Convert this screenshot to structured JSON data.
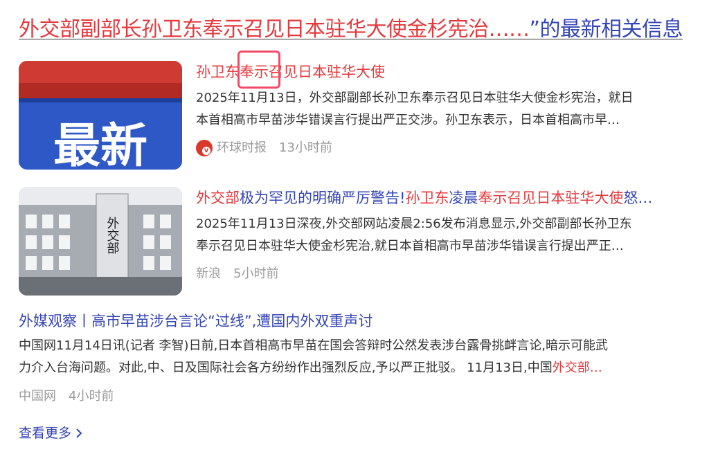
{
  "header": {
    "title_red": "外交部副部长孙卫东奉示召见日本驻华大使金杉宪治……",
    "title_blue": "”的最新相关信息"
  },
  "results": [
    {
      "thumb_text": "最新",
      "title": "孙卫东奉示召见日本驻华大使",
      "body_line1": "2025年11月13日，外交部副部长孙卫东奉示召见日本驻华大使金杉宪治，就日",
      "body_line2": "本首相高市早苗涉华错误言行提出严正交涉。孙卫东表示，日本首相高市早…",
      "source": "环球时报",
      "time": "13小时前"
    },
    {
      "title_parts": [
        "外交部",
        "极为罕见的明确严厉警告!",
        "孙卫东",
        "凌晨",
        "奉示召见日本驻华大使",
        "怒…"
      ],
      "thumb_sign": "外交部",
      "body_line1": "2025年11月13日深夜,外交部网站凌晨2:56发布消息显示,外交部副部长孙卫东",
      "body_line2": "奉示召见日本驻华大使金杉宪治,就日本首相高市早苗涉华错误言行提出严正…",
      "source": "新浪",
      "time": "5小时前"
    },
    {
      "title": "外媒观察丨高市早苗涉台言论“过线”,遭国内外双重声讨",
      "body_line1": "中国网11月14日讯(记者 李智)日前,日本首相高市早苗在国会答辩时公然发表涉台露骨挑衅言论,暗示可能武",
      "body_line2_a": "力介入台海问题。对此,中、日及国际社会各方纷纷作出强烈反应,予以严正批驳。 11月13日,中国",
      "body_line2_b": "外交部…",
      "source": "中国网",
      "time": "4小时前"
    }
  ],
  "more_label": "查看更多",
  "colors": {
    "highlight": "#e4393c",
    "link": "#3445b4",
    "meta": "#9a9a9a",
    "box": "#f24a6a"
  },
  "icons": {
    "source_icon": "huanqiu-logo-icon",
    "more_arrow": "chevron-right-icon"
  }
}
